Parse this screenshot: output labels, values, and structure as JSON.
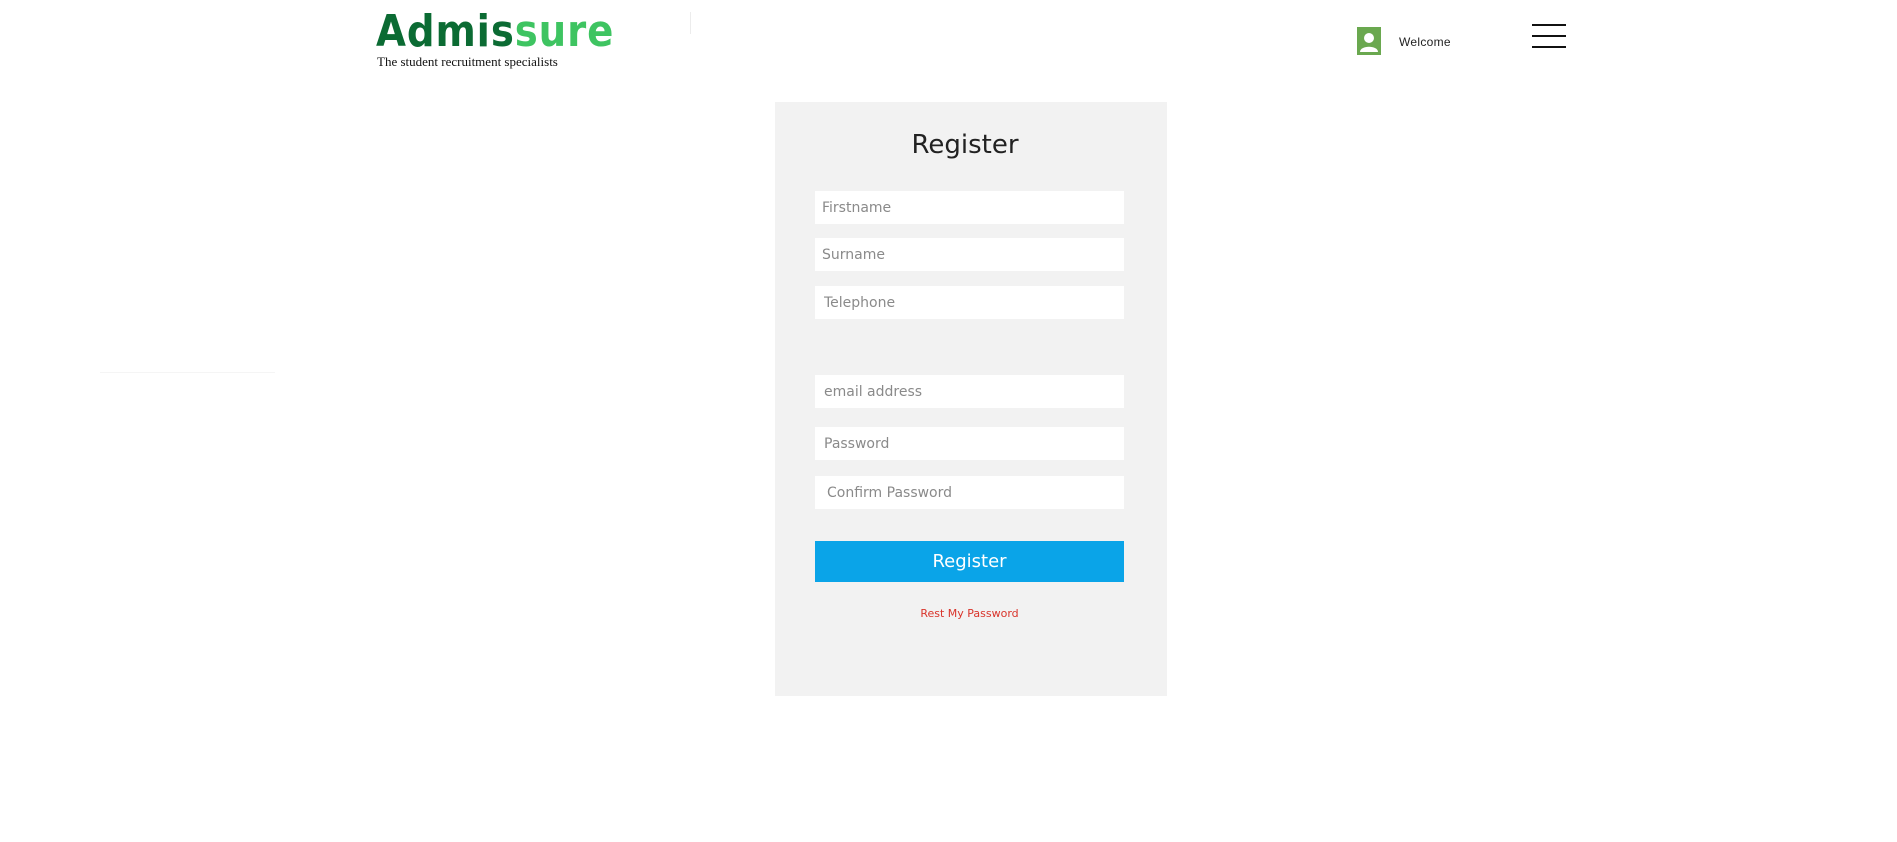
{
  "header": {
    "logo": {
      "part1": "Admis",
      "part2": "sure",
      "tagline": "The student recruitment specialists"
    },
    "user": {
      "avatar_icon": "user-avatar-icon",
      "welcome_text": "Welcome"
    },
    "menu_icon": "hamburger-menu-icon"
  },
  "form": {
    "title": "Register",
    "fields": {
      "firstname": {
        "placeholder": "Firstname",
        "value": ""
      },
      "surname": {
        "placeholder": "Surname",
        "value": ""
      },
      "telephone": {
        "placeholder": "Telephone",
        "value": ""
      },
      "email": {
        "placeholder": "email address",
        "value": ""
      },
      "password": {
        "placeholder": "Password",
        "value": ""
      },
      "confirm_password": {
        "placeholder": "Confirm Password",
        "value": ""
      }
    },
    "submit_label": "Register",
    "reset_link": "Rest My Password"
  },
  "colors": {
    "logo_dark_green": "#0b6b33",
    "logo_light_green": "#3ec461",
    "avatar_green": "#6aa84f",
    "panel_background": "#f2f2f2",
    "button_blue": "#0aa4e8",
    "link_red": "#d9342b"
  }
}
